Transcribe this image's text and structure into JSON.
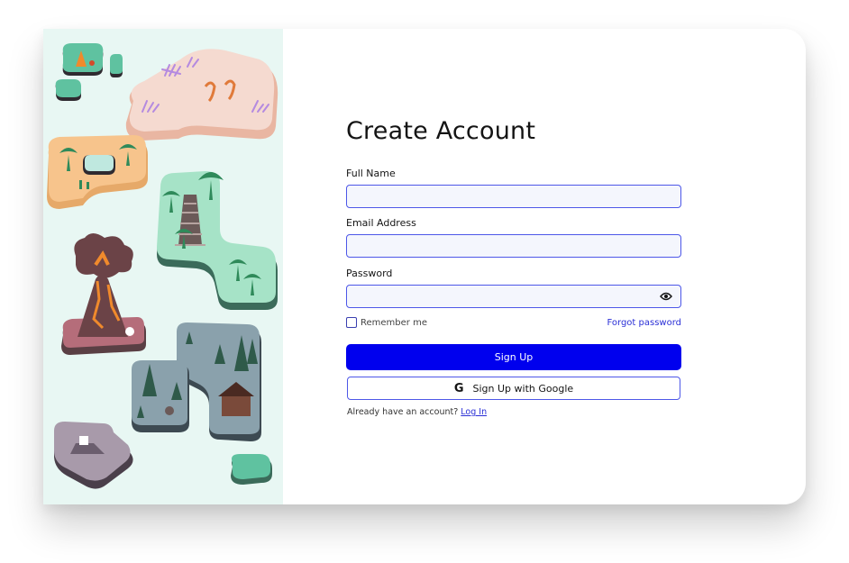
{
  "form": {
    "title": "Create Account",
    "full_name_label": "Full Name",
    "full_name_value": "",
    "email_label": "Email Address",
    "email_value": "",
    "password_label": "Password",
    "password_value": "",
    "remember_label": "Remember me",
    "forgot_label": "Forgot password",
    "signup_label": "Sign Up",
    "google_label": "Sign Up with Google",
    "google_icon": "G",
    "already_text": "Already have an account?",
    "login_label": "Log In"
  },
  "icons": {
    "password_toggle": "eye-icon",
    "google": "google-icon"
  },
  "colors": {
    "primary": "#0000ee",
    "input_border": "#4d57e8",
    "input_bg": "#f4f6fd",
    "art_bg": "#e8f7f3"
  }
}
